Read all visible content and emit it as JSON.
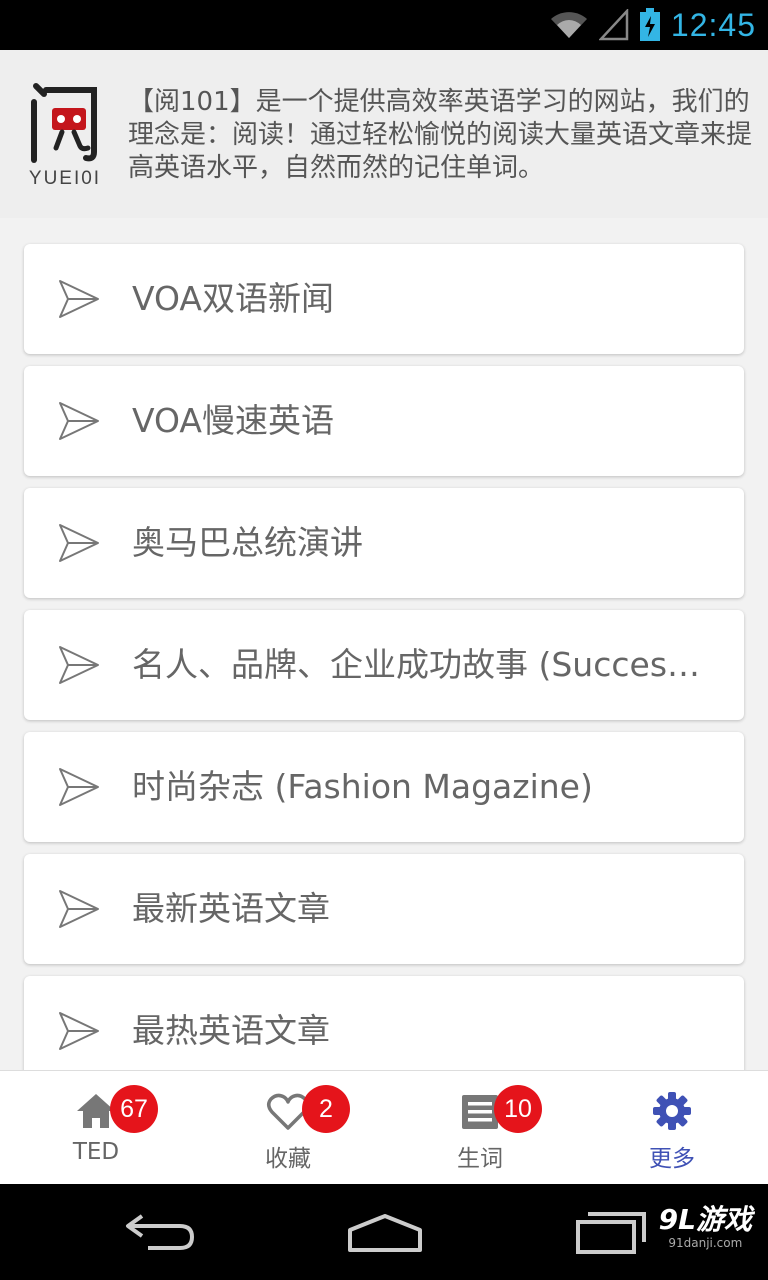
{
  "status_bar": {
    "time": "12:45",
    "icons": [
      "wifi-icon",
      "signal-icon",
      "battery-charging-icon"
    ],
    "accent_color": "#33b5e5"
  },
  "header": {
    "logo_text": "YUEI0I",
    "intro": "【阅101】是一个提供高效率英语学习的网站，我们的理念是：阅读！通过轻松愉悦的阅读大量英语文章来提高英语水平，自然而然的记住单词。"
  },
  "list": {
    "items": [
      {
        "label": "VOA双语新闻",
        "icon": "send-icon"
      },
      {
        "label": "VOA慢速英语",
        "icon": "send-icon"
      },
      {
        "label": "奥马巴总统演讲",
        "icon": "send-icon"
      },
      {
        "label": "名人、品牌、企业成功故事 (Success Stories)",
        "icon": "send-icon"
      },
      {
        "label": "时尚杂志 (Fashion Magazine)",
        "icon": "send-icon"
      },
      {
        "label": "最新英语文章",
        "icon": "send-icon"
      },
      {
        "label": "最热英语文章",
        "icon": "send-icon"
      }
    ]
  },
  "tabbar": {
    "tabs": [
      {
        "label": "TED",
        "icon": "home-icon",
        "badge": "67",
        "active": false
      },
      {
        "label": "收藏",
        "icon": "heart-icon",
        "badge": "2",
        "active": false
      },
      {
        "label": "生词",
        "icon": "vocabulary-icon",
        "badge": "10",
        "active": false
      },
      {
        "label": "更多",
        "icon": "gear-icon",
        "badge": null,
        "active": true
      }
    ],
    "active_color": "#3f51b5",
    "badge_color": "#e5141b"
  },
  "navbar": {
    "buttons": [
      "back-icon",
      "home-nav-icon",
      "recents-icon"
    ],
    "watermark": "9L游戏",
    "watermark_sub": "91danji.com"
  }
}
